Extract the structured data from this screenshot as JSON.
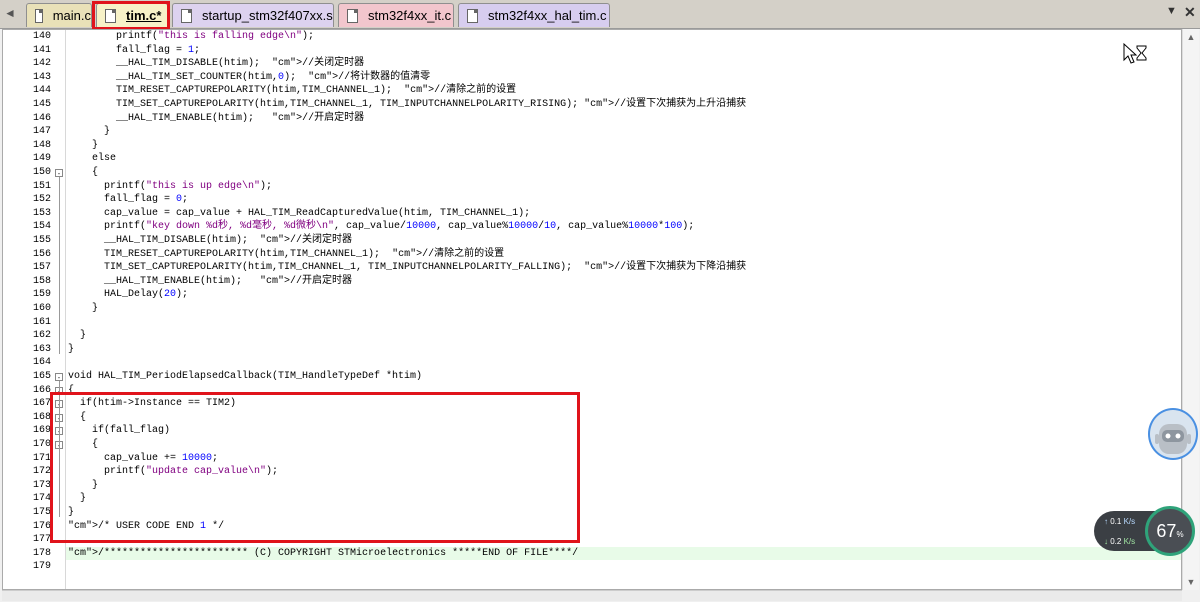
{
  "tabs": [
    {
      "label": "main.c"
    },
    {
      "label": "tim.c*"
    },
    {
      "label": "startup_stm32f407xx.s"
    },
    {
      "label": "stm32f4xx_it.c"
    },
    {
      "label": "stm32f4xx_hal_tim.c"
    }
  ],
  "tab_controls": {
    "scroll_left": "◄",
    "menu": "▼",
    "close": "✕"
  },
  "colors": {
    "highlight_box": "#e0131b",
    "comment": "#008000",
    "string": "#800080",
    "number": "#0000ff"
  },
  "code_lines": [
    {
      "n": "140",
      "t": "        printf(\"this is falling edge\\n\");"
    },
    {
      "n": "141",
      "t": "        fall_flag = 1;"
    },
    {
      "n": "142",
      "t": "        __HAL_TIM_DISABLE(htim);  //关闭定时器"
    },
    {
      "n": "143",
      "t": "        __HAL_TIM_SET_COUNTER(htim,0);  //将计数器的值清零"
    },
    {
      "n": "144",
      "t": "        TIM_RESET_CAPTUREPOLARITY(htim,TIM_CHANNEL_1);  //清除之前的设置"
    },
    {
      "n": "145",
      "t": "        TIM_SET_CAPTUREPOLARITY(htim,TIM_CHANNEL_1, TIM_INPUTCHANNELPOLARITY_RISING); //设置下次捕获为上升沿捕获"
    },
    {
      "n": "146",
      "t": "        __HAL_TIM_ENABLE(htim);   //开启定时器"
    },
    {
      "n": "147",
      "t": "      }"
    },
    {
      "n": "148",
      "t": "    }"
    },
    {
      "n": "149",
      "t": "    else"
    },
    {
      "n": "150",
      "t": "    {"
    },
    {
      "n": "151",
      "t": "      printf(\"this is up edge\\n\");"
    },
    {
      "n": "152",
      "t": "      fall_flag = 0;"
    },
    {
      "n": "153",
      "t": "      cap_value = cap_value + HAL_TIM_ReadCapturedValue(htim, TIM_CHANNEL_1);"
    },
    {
      "n": "154",
      "t": "      printf(\"key down %d秒, %d毫秒, %d微秒\\n\", cap_value/10000, cap_value%10000/10, cap_value%10000*100);"
    },
    {
      "n": "155",
      "t": "      __HAL_TIM_DISABLE(htim);  //关闭定时器"
    },
    {
      "n": "156",
      "t": "      TIM_RESET_CAPTUREPOLARITY(htim,TIM_CHANNEL_1);  //清除之前的设置"
    },
    {
      "n": "157",
      "t": "      TIM_SET_CAPTUREPOLARITY(htim,TIM_CHANNEL_1, TIM_INPUTCHANNELPOLARITY_FALLING);  //设置下次捕获为下降沿捕获"
    },
    {
      "n": "158",
      "t": "      __HAL_TIM_ENABLE(htim);   //开启定时器"
    },
    {
      "n": "159",
      "t": "      HAL_Delay(20);"
    },
    {
      "n": "160",
      "t": "    }"
    },
    {
      "n": "161",
      "t": ""
    },
    {
      "n": "162",
      "t": "  }"
    },
    {
      "n": "163",
      "t": "}"
    },
    {
      "n": "164",
      "t": ""
    },
    {
      "n": "165",
      "t": "void HAL_TIM_PeriodElapsedCallback(TIM_HandleTypeDef *htim)"
    },
    {
      "n": "166",
      "t": "{"
    },
    {
      "n": "167",
      "t": "  if(htim->Instance == TIM2)"
    },
    {
      "n": "168",
      "t": "  {"
    },
    {
      "n": "169",
      "t": "    if(fall_flag)"
    },
    {
      "n": "170",
      "t": "    {"
    },
    {
      "n": "171",
      "t": "      cap_value += 10000;"
    },
    {
      "n": "172",
      "t": "      printf(\"update cap_value\\n\");"
    },
    {
      "n": "173",
      "t": "    }"
    },
    {
      "n": "174",
      "t": "  }"
    },
    {
      "n": "175",
      "t": "}"
    },
    {
      "n": "176",
      "t": "/* USER CODE END 1 */"
    },
    {
      "n": "177",
      "t": ""
    },
    {
      "n": "178",
      "t": "/************************ (C) COPYRIGHT STMicroelectronics *****END OF FILE****/"
    },
    {
      "n": "179",
      "t": ""
    }
  ],
  "net_widget": {
    "up_value": "0.1",
    "up_unit": "K/s",
    "down_value": "0.2",
    "down_unit": "K/s"
  },
  "gauge": {
    "value": "67",
    "unit": "%"
  }
}
